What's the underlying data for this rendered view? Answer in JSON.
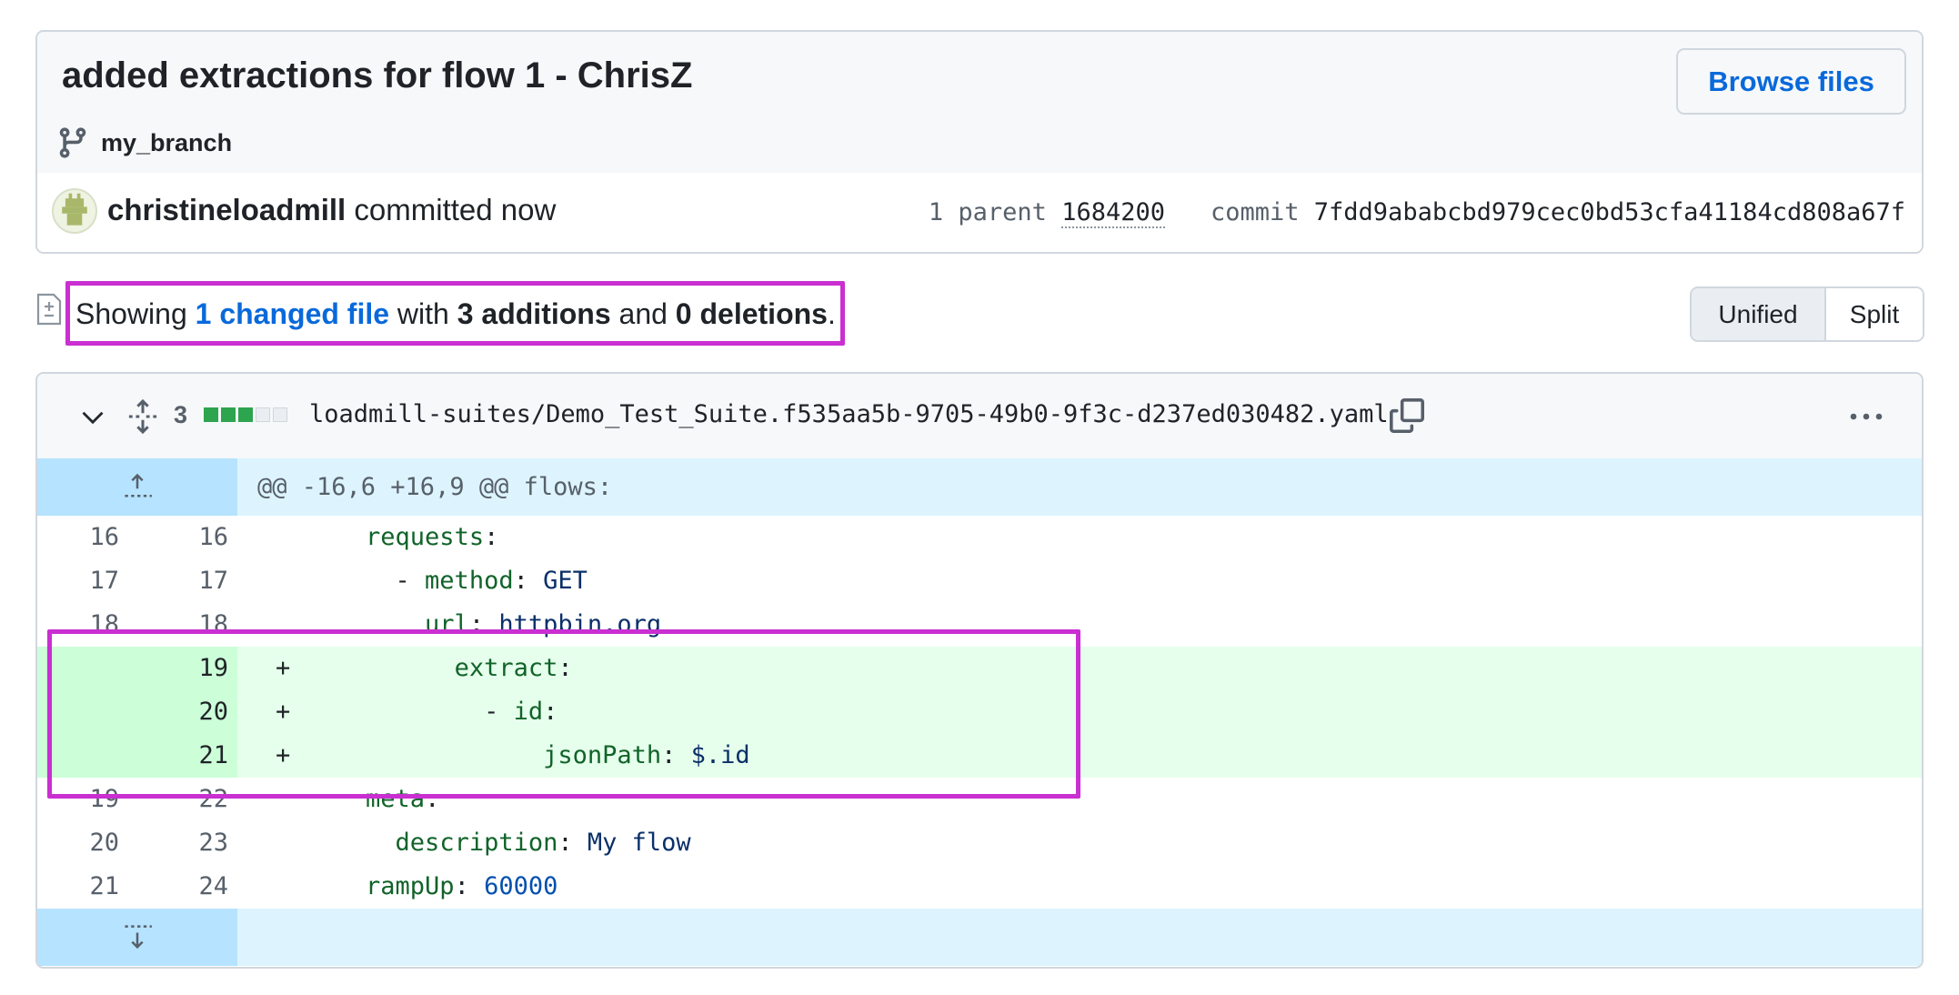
{
  "commit": {
    "title": "added extractions for flow 1 - ChrisZ",
    "branch": "my_branch",
    "browse_label": "Browse files",
    "author": "christineloadmill",
    "committed_text": " committed now",
    "parent_label": "1 parent ",
    "parent_hash": "1684200",
    "commit_label": "commit ",
    "commit_hash": "7fdd9ababcbd979cec0bd53cfa41184cd808a67f"
  },
  "summary": {
    "prefix": "Showing ",
    "changed_link": "1 changed file",
    "mid1": " with ",
    "additions": "3 additions",
    "mid2": " and ",
    "deletions": "0 deletions",
    "suffix": "."
  },
  "view_toggle": {
    "unified": "Unified",
    "split": "Split",
    "selected": "Unified"
  },
  "file": {
    "change_count": "3",
    "diffstat": {
      "additions": 3,
      "deletions": 0
    },
    "path": "loadmill-suites/Demo_Test_Suite.f535aa5b-9705-49b0-9f3c-d237ed030482.yaml",
    "hunk_header": "@@ -16,6 +16,9 @@ flows:",
    "lines": [
      {
        "old": "16",
        "new": "16",
        "type": "ctx",
        "sign": "",
        "indent": "    ",
        "key": "requests",
        "sep": ":",
        "value": ""
      },
      {
        "old": "17",
        "new": "17",
        "type": "ctx",
        "sign": "",
        "indent": "      - ",
        "key": "method",
        "sep": ": ",
        "value": "GET"
      },
      {
        "old": "18",
        "new": "18",
        "type": "ctx",
        "sign": "",
        "indent": "        ",
        "key": "url",
        "sep": ": ",
        "value": "httpbin.org"
      },
      {
        "old": "",
        "new": "19",
        "type": "add",
        "sign": "+",
        "indent": "          ",
        "key": "extract",
        "sep": ":",
        "value": ""
      },
      {
        "old": "",
        "new": "20",
        "type": "add",
        "sign": "+",
        "indent": "            - ",
        "key": "id",
        "sep": ":",
        "value": ""
      },
      {
        "old": "",
        "new": "21",
        "type": "add",
        "sign": "+",
        "indent": "                ",
        "key": "jsonPath",
        "sep": ": ",
        "value": "$.id"
      },
      {
        "old": "19",
        "new": "22",
        "type": "ctx",
        "sign": "",
        "indent": "    ",
        "key": "meta",
        "sep": ":",
        "value": ""
      },
      {
        "old": "20",
        "new": "23",
        "type": "ctx",
        "sign": "",
        "indent": "      ",
        "key": "description",
        "sep": ": ",
        "value": "My flow"
      },
      {
        "old": "21",
        "new": "24",
        "type": "ctx",
        "sign": "",
        "indent": "    ",
        "key": "rampUp",
        "sep": ": ",
        "value": "60000"
      }
    ]
  },
  "colors": {
    "highlight": "#c92fd1",
    "link": "#0969da",
    "add_bg": "#e6ffec",
    "hunk_bg": "#ddf4ff"
  }
}
